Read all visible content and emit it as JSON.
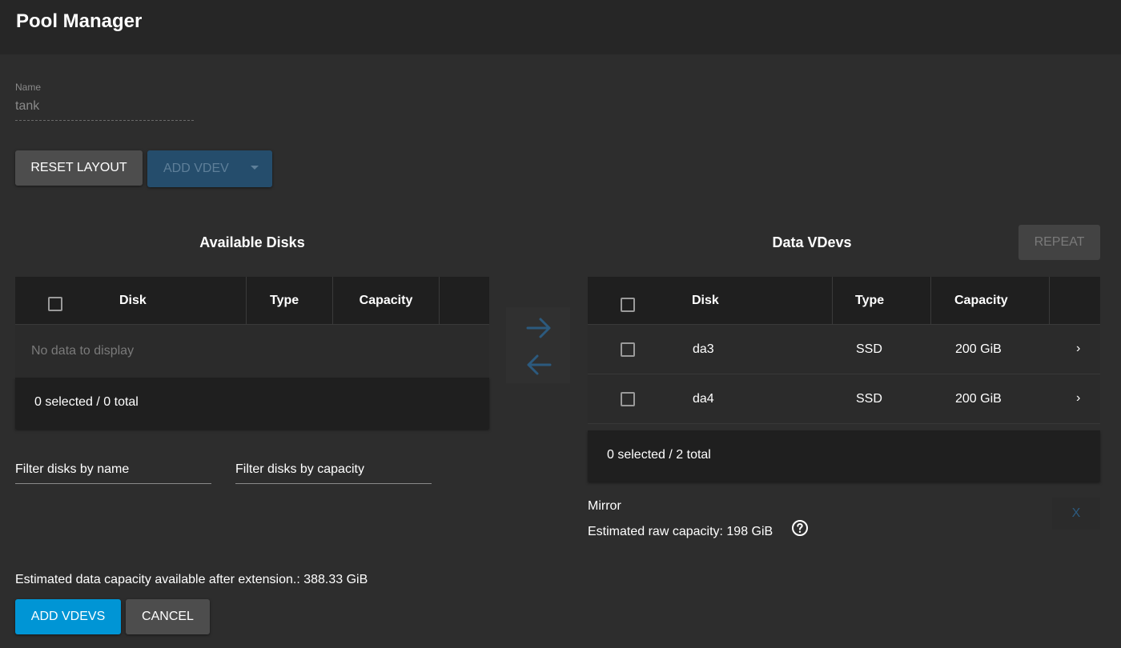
{
  "header": {
    "title": "Pool Manager"
  },
  "name_field": {
    "label": "Name",
    "value": "tank"
  },
  "toolbar": {
    "reset_label": "RESET LAYOUT",
    "add_vdev_label": "ADD VDEV"
  },
  "available": {
    "title": "Available Disks",
    "columns": [
      "Disk",
      "Type",
      "Capacity"
    ],
    "empty_text": "No data to display",
    "footer": "0 selected / 0 total",
    "filter_name_placeholder": "Filter disks by name",
    "filter_capacity_placeholder": "Filter disks by capacity"
  },
  "data_vdevs": {
    "title": "Data VDevs",
    "repeat_label": "REPEAT",
    "columns": [
      "Disk",
      "Type",
      "Capacity"
    ],
    "rows": [
      {
        "disk": "da3",
        "type": "SSD",
        "capacity": "200 GiB"
      },
      {
        "disk": "da4",
        "type": "SSD",
        "capacity": "200 GiB"
      }
    ],
    "footer": "0 selected / 2 total",
    "layout": "Mirror",
    "raw_capacity": "Estimated raw capacity: 198 GiB",
    "remove_label": "X"
  },
  "summary": {
    "estimated": "Estimated data capacity available after extension.: 388.33 GiB"
  },
  "actions": {
    "add_vdevs_label": "ADD VDEVS",
    "cancel_label": "CANCEL"
  },
  "colors": {
    "accent": "#0095d5",
    "disabled_blue": "#254d6c",
    "arrow": "#2c5a7e"
  },
  "icons": [
    "arrow-right-icon",
    "arrow-left-icon",
    "help-circle-icon",
    "chevron-right-icon",
    "caret-down-icon"
  ]
}
